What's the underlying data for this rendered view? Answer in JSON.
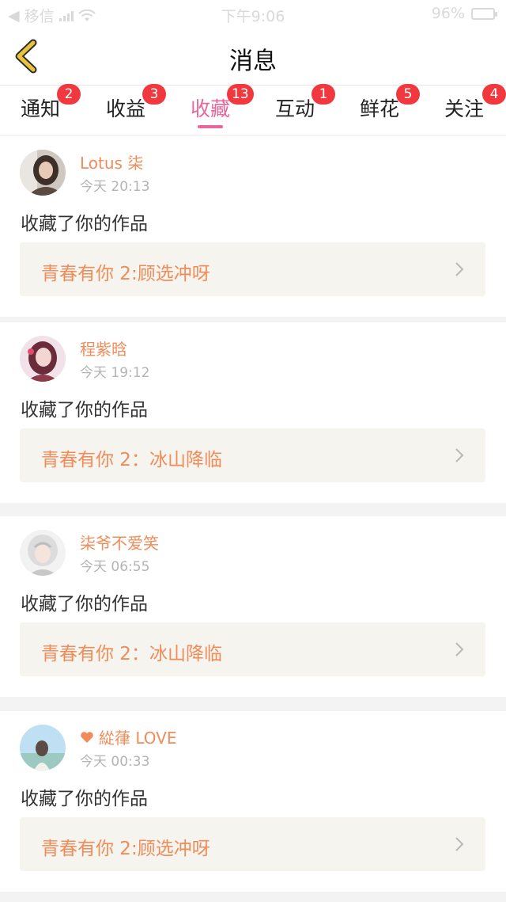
{
  "status_bar": {
    "carrier": "移信",
    "time": "下午9:06",
    "battery": "96%",
    "battery_level": 0.96
  },
  "header": {
    "title": "消息",
    "back_icon": "chevron-left-icon"
  },
  "tabs": [
    {
      "label": "通知",
      "badge": "2",
      "active": false
    },
    {
      "label": "收益",
      "badge": "3",
      "active": false
    },
    {
      "label": "收藏",
      "badge": "13",
      "active": true
    },
    {
      "label": "互动",
      "badge": "1",
      "active": false
    },
    {
      "label": "鲜花",
      "badge": "5",
      "active": false
    },
    {
      "label": "关注",
      "badge": "4",
      "active": false
    }
  ],
  "messages": [
    {
      "user": "Lotus 柒",
      "time": "今天 20:13",
      "text": "收藏了你的作品",
      "work": "青春有你 2:顾选冲呀"
    },
    {
      "user": "程紫晗",
      "time": "今天 19:12",
      "text": "收藏了你的作品",
      "work": "青春有你 2：冰山降临"
    },
    {
      "user": "柒爷不爱笑",
      "time": "今天 06:55",
      "text": "收藏了你的作品",
      "work": "青春有你 2：冰山降临"
    },
    {
      "user": "緃葎 LOVE",
      "time": "今天 00:33",
      "text": "收藏了你的作品",
      "work": "青春有你 2:顾选冲呀",
      "user_icon": "heart-icon"
    }
  ],
  "colors": {
    "accent": "#e9669b",
    "username": "#f08c5a",
    "badge": "#f0383e",
    "work_bg": "#f5f4ee",
    "back_icon": "#e8c43a"
  }
}
